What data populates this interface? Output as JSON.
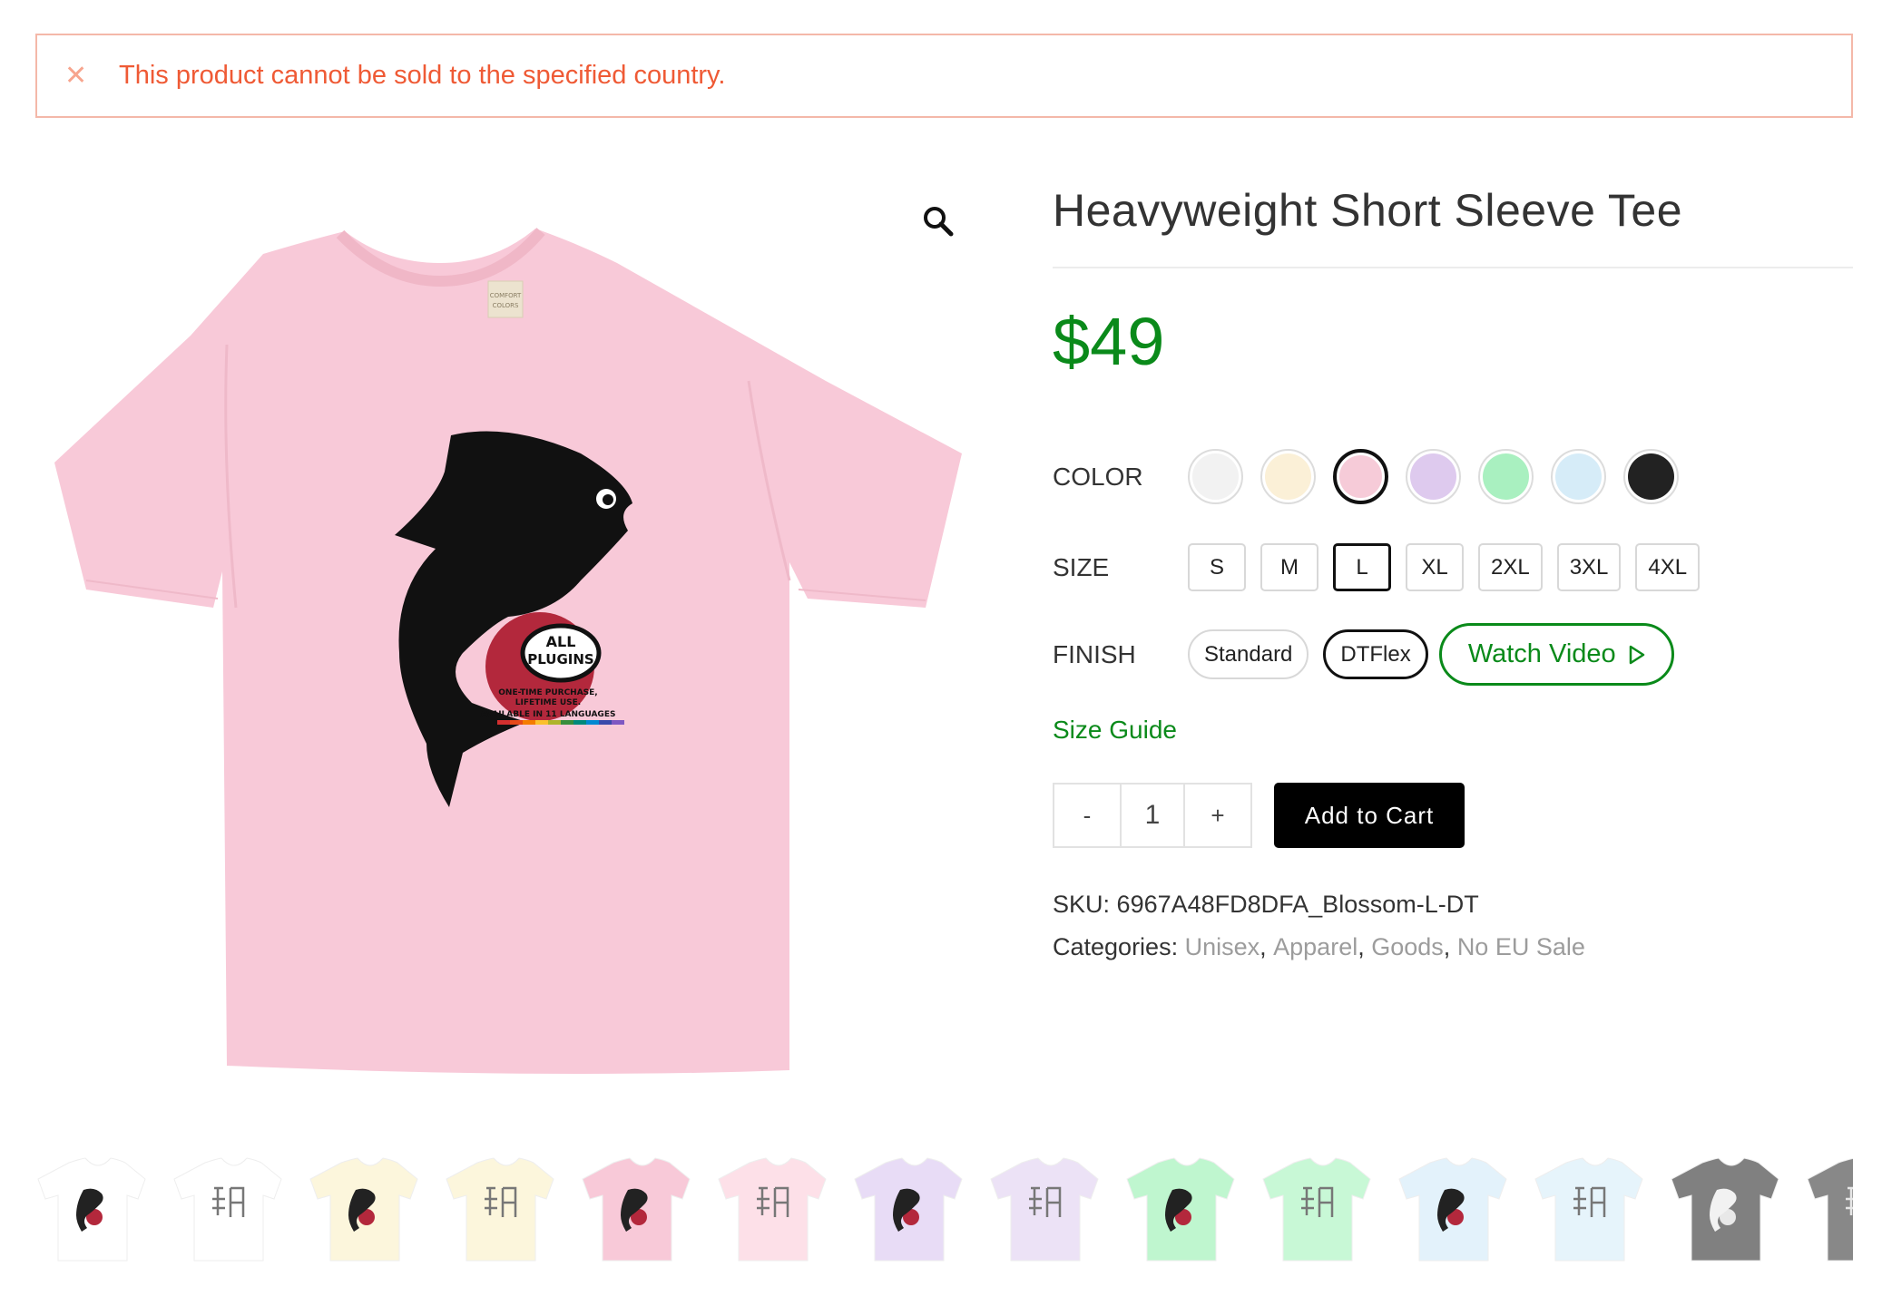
{
  "notice": {
    "icon": "close-icon",
    "message": "This product cannot be sold to the specified country."
  },
  "gallery": {
    "zoom_icon": "magnifier-icon",
    "main_image": {
      "shirt_color": "#f8c9d8",
      "print": {
        "badge_line1": "ALL",
        "badge_line2": "PLUGINS",
        "tagline1": "ONE-TIME PURCHASE,",
        "tagline2": "LIFETIME USE.",
        "tagline3": "AVAILABLE IN 11 LANGUAGES"
      },
      "neck_label_line1": "COMFORT",
      "neck_label_line2": "COLORS"
    }
  },
  "product": {
    "title": "Heavyweight Short Sleeve Tee",
    "price": "$49",
    "color_label": "COLOR",
    "colors": [
      {
        "hex": "#f2f2f2",
        "selected": false
      },
      {
        "hex": "#fbf0d7",
        "selected": false
      },
      {
        "hex": "#f6cbd8",
        "selected": true
      },
      {
        "hex": "#decaee",
        "selected": false
      },
      {
        "hex": "#a9f0c0",
        "selected": false
      },
      {
        "hex": "#d6ecf8",
        "selected": false
      },
      {
        "hex": "#222222",
        "selected": false
      }
    ],
    "size_label": "SIZE",
    "sizes": [
      {
        "label": "S",
        "selected": false
      },
      {
        "label": "M",
        "selected": false
      },
      {
        "label": "L",
        "selected": true
      },
      {
        "label": "XL",
        "selected": false
      },
      {
        "label": "2XL",
        "selected": false
      },
      {
        "label": "3XL",
        "selected": false
      },
      {
        "label": "4XL",
        "selected": false
      }
    ],
    "finish_label": "FINISH",
    "finishes": [
      {
        "label": "Standard",
        "selected": false
      },
      {
        "label": "DTFlex",
        "selected": true
      }
    ],
    "watch_video": "Watch Video",
    "size_guide": "Size Guide",
    "quantity": {
      "minus": "-",
      "value": "1",
      "plus": "+"
    },
    "add_to_cart": "Add to Cart",
    "sku_label": "SKU:",
    "sku": "6967A48FD8DFA_Blossom-L-DT",
    "categories_label": "Categories:",
    "categories": [
      "Unisex",
      "Apparel",
      "Goods",
      "No EU Sale"
    ]
  },
  "thumbnails": [
    {
      "shirt": "#ffffff",
      "design": "fish"
    },
    {
      "shirt": "#ffffff",
      "design": "glyph"
    },
    {
      "shirt": "#fcf6dc",
      "design": "fish"
    },
    {
      "shirt": "#fcf6dc",
      "design": "glyph"
    },
    {
      "shirt": "#f8c9d8",
      "design": "fish"
    },
    {
      "shirt": "#fde0e8",
      "design": "glyph"
    },
    {
      "shirt": "#e8dcf6",
      "design": "fish"
    },
    {
      "shirt": "#ece2f6",
      "design": "glyph"
    },
    {
      "shirt": "#bff6cf",
      "design": "fish"
    },
    {
      "shirt": "#c8f8d6",
      "design": "glyph"
    },
    {
      "shirt": "#e3f2fb",
      "design": "fish"
    },
    {
      "shirt": "#e6f4fb",
      "design": "glyph"
    },
    {
      "shirt": "#808080",
      "design": "fish-light"
    },
    {
      "shirt": "#888888",
      "design": "glyph-light"
    }
  ]
}
